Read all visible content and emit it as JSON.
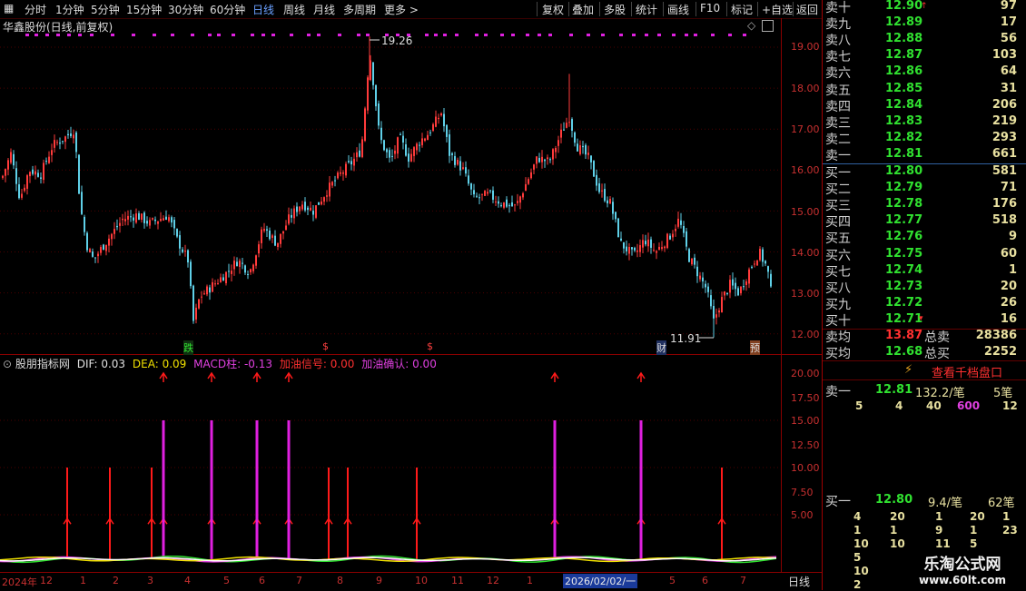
{
  "toolbar": {
    "periods": [
      "分时",
      "1分钟",
      "5分钟",
      "15分钟",
      "30分钟",
      "60分钟",
      "日线",
      "周线",
      "月线",
      "多周期",
      "更多 >"
    ],
    "active": "日线",
    "right_buttons": [
      "复权",
      "叠加",
      "多股",
      "统计",
      "画线",
      "F10",
      "标记",
      "+自选",
      "返回"
    ]
  },
  "main_chart": {
    "title": "华鑫股份(日线,前复权)",
    "y_ticks": [
      "19.00",
      "18.00",
      "17.00",
      "16.00",
      "15.00",
      "14.00",
      "13.00",
      "12.00"
    ],
    "high_label": "19.26",
    "low_label": "11.91",
    "markers": [
      "跌",
      "$",
      "$",
      "财",
      "预"
    ],
    "colors": {
      "up": "#ff3b3b",
      "down": "#5fd0e8",
      "grid": "#5a0000"
    }
  },
  "indicator": {
    "name": "股朋指标网",
    "dif_label": "DIF: 0.03",
    "dea_label": "DEA: 0.09",
    "macd_label": "MACD柱: -0.13",
    "signal_label": "加油信号: 0.00",
    "confirm_label": "加油确认: 0.00",
    "y_ticks": [
      "20.00",
      "17.50",
      "15.00",
      "12.50",
      "10.00",
      "7.50",
      "5.00"
    ]
  },
  "x_axis": {
    "labels": [
      "2024年",
      "12",
      "1",
      "2",
      "3",
      "4",
      "5",
      "6",
      "7",
      "8",
      "9",
      "10",
      "11",
      "12",
      "1",
      "5",
      "6",
      "7"
    ],
    "highlight": "2026/02/02/一",
    "period_label": "日线"
  },
  "order_book": {
    "sells": [
      {
        "label": "卖十",
        "price": "12.90",
        "vol": "97"
      },
      {
        "label": "卖九",
        "price": "12.89",
        "vol": "17"
      },
      {
        "label": "卖八",
        "price": "12.88",
        "vol": "56"
      },
      {
        "label": "卖七",
        "price": "12.87",
        "vol": "103"
      },
      {
        "label": "卖六",
        "price": "12.86",
        "vol": "64"
      },
      {
        "label": "卖五",
        "price": "12.85",
        "vol": "31"
      },
      {
        "label": "卖四",
        "price": "12.84",
        "vol": "206"
      },
      {
        "label": "卖三",
        "price": "12.83",
        "vol": "219"
      },
      {
        "label": "卖二",
        "price": "12.82",
        "vol": "293"
      },
      {
        "label": "卖一",
        "price": "12.81",
        "vol": "661"
      }
    ],
    "buys": [
      {
        "label": "买一",
        "price": "12.80",
        "vol": "581"
      },
      {
        "label": "买二",
        "price": "12.79",
        "vol": "71"
      },
      {
        "label": "买三",
        "price": "12.78",
        "vol": "176"
      },
      {
        "label": "买四",
        "price": "12.77",
        "vol": "518"
      },
      {
        "label": "买五",
        "price": "12.76",
        "vol": "9"
      },
      {
        "label": "买六",
        "price": "12.75",
        "vol": "60"
      },
      {
        "label": "买七",
        "price": "12.74",
        "vol": "1"
      },
      {
        "label": "买八",
        "price": "12.73",
        "vol": "20"
      },
      {
        "label": "买九",
        "price": "12.72",
        "vol": "26"
      },
      {
        "label": "买十",
        "price": "12.71",
        "vol": "16"
      }
    ],
    "avg_sell": {
      "label": "卖均",
      "price": "13.87",
      "total_label": "总卖",
      "total": "28386"
    },
    "avg_buy": {
      "label": "买均",
      "price": "12.68",
      "total_label": "总买",
      "total": "2252"
    },
    "depth_button": "查看千档盘口",
    "sell1_row": {
      "label": "卖一",
      "price": "12.81",
      "amount": "132.2/笔",
      "count": "5笔"
    },
    "sell1_queue": [
      "5",
      "4",
      "40",
      "600",
      "12"
    ],
    "buy1_row": {
      "label": "买一",
      "price": "12.80",
      "amount": "9.4/笔",
      "count": "62笔"
    },
    "buy1_queue": [
      [
        "4",
        "20",
        "1",
        "20",
        "1"
      ],
      [
        "1",
        "1",
        "9",
        "1",
        "23"
      ],
      [
        "10",
        "10",
        "11",
        "5",
        ""
      ],
      [
        "5",
        "",
        "",
        "",
        ""
      ],
      [
        "10",
        "",
        "",
        "",
        ""
      ],
      [
        "2",
        "",
        "",
        "",
        ""
      ]
    ]
  },
  "watermark": {
    "name": "乐淘公式网",
    "url": "www.60lt.com"
  }
}
